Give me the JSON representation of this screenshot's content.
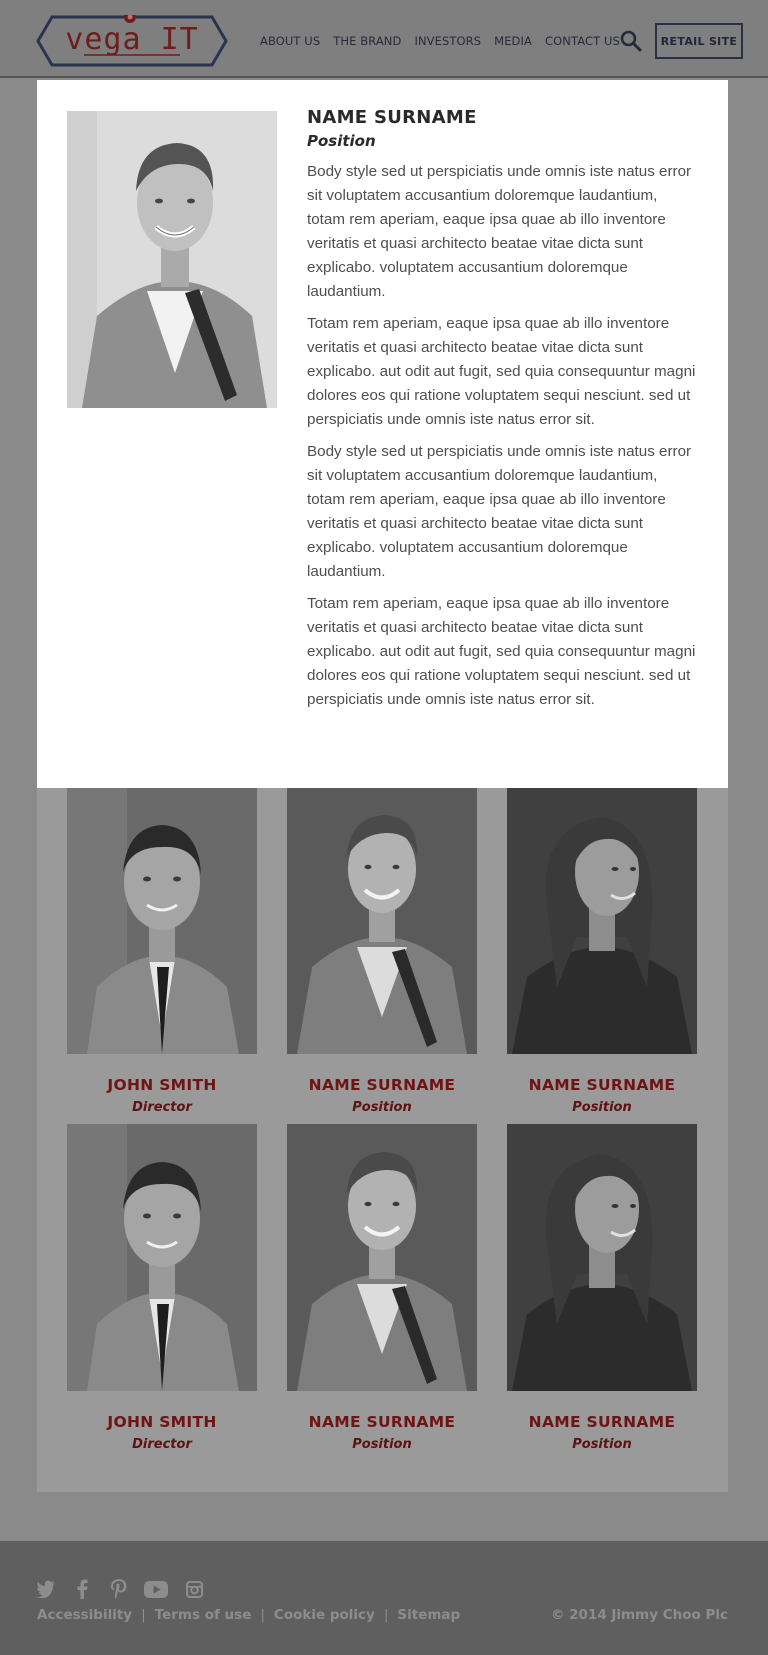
{
  "brand": {
    "logo_text": "vega IT",
    "accent": "#6e1d1d",
    "logo_outline": "#2a3350"
  },
  "nav": {
    "items": [
      "ABOUT US",
      "THE BRAND",
      "INVESTORS",
      "MEDIA",
      "CONTACT US"
    ],
    "search_icon": "search-icon",
    "retail_label": "RETAIL SITE"
  },
  "modal": {
    "name": "NAME SURNAME",
    "position": "Position",
    "paragraphs": [
      "Body style sed ut perspiciatis unde omnis iste natus error sit voluptatem accusantium doloremque laudantium, totam rem aperiam, eaque ipsa quae ab illo inventore veritatis et quasi architecto beatae vitae dicta sunt explicabo. voluptatem accusantium doloremque laudantium.",
      "Totam rem aperiam, eaque ipsa quae ab illo inventore veritatis et quasi architecto beatae vitae dicta sunt explicabo. aut odit aut fugit, sed quia consequuntur magni dolores eos qui ratione voluptatem sequi nesciunt. sed ut perspiciatis unde omnis iste natus error sit.",
      "Body style sed ut perspiciatis unde omnis iste natus error sit voluptatem accusantium doloremque laudantium, totam rem aperiam, eaque ipsa quae ab illo inventore veritatis et quasi architecto beatae vitae dicta sunt explicabo. voluptatem accusantium doloremque laudantium.",
      "Totam rem aperiam, eaque ipsa quae ab illo inventore veritatis et quasi architecto beatae vitae dicta sunt explicabo. aut odit aut fugit, sed quia consequuntur magni dolores eos qui ratione voluptatem sequi nesciunt. sed ut perspiciatis unde omnis iste natus error sit."
    ]
  },
  "team": [
    {
      "name": "JOHN SMITH",
      "position": "Director",
      "photo": "man-portrait"
    },
    {
      "name": "NAME SURNAME",
      "position": "Position",
      "photo": "woman-short-hair-portrait"
    },
    {
      "name": "NAME SURNAME",
      "position": "Position",
      "photo": "woman-long-hair-portrait"
    },
    {
      "name": "JOHN SMITH",
      "position": "Director",
      "photo": "man-portrait"
    },
    {
      "name": "NAME SURNAME",
      "position": "Position",
      "photo": "woman-short-hair-portrait"
    },
    {
      "name": "NAME SURNAME",
      "position": "Position",
      "photo": "woman-long-hair-portrait"
    }
  ],
  "footer": {
    "social": [
      "twitter-icon",
      "facebook-icon",
      "pinterest-icon",
      "youtube-icon",
      "instagram-icon"
    ],
    "links": [
      "Accessibility",
      "Terms of use",
      "Cookie policy",
      "Sitemap"
    ],
    "separator": "|",
    "copyright": "© 2014 Jimmy Choo Plc"
  }
}
